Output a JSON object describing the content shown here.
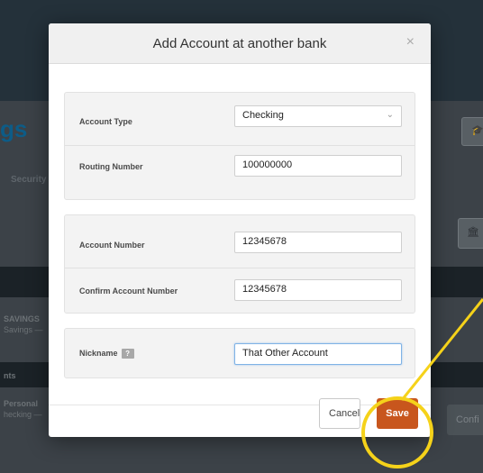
{
  "background": {
    "page_title_fragment": "gs",
    "tab_fragment": "Security",
    "list_items": [
      {
        "line1": "SAVINGS",
        "line2": "Savings —"
      },
      {
        "line1": "Personal",
        "line2": "hecking — "
      }
    ],
    "section_fragment": "nts",
    "confirm_fragment": "Confi"
  },
  "modal": {
    "title": "Add Account at another bank",
    "close_glyph": "×",
    "fields": {
      "account_type": {
        "label": "Account Type",
        "value": "Checking"
      },
      "routing_number": {
        "label": "Routing Number",
        "value": "100000000"
      },
      "account_number": {
        "label": "Account Number",
        "value": "12345678"
      },
      "confirm_account_number": {
        "label": "Confirm Account Number",
        "value": "12345678"
      },
      "nickname": {
        "label": "Nickname",
        "help": "?",
        "value": "That Other Account"
      }
    },
    "buttons": {
      "cancel": "Cancel",
      "save": "Save"
    }
  },
  "colors": {
    "save_button": "#c8561d",
    "callout": "#f5d21a",
    "title_blue": "#0d5c87"
  }
}
